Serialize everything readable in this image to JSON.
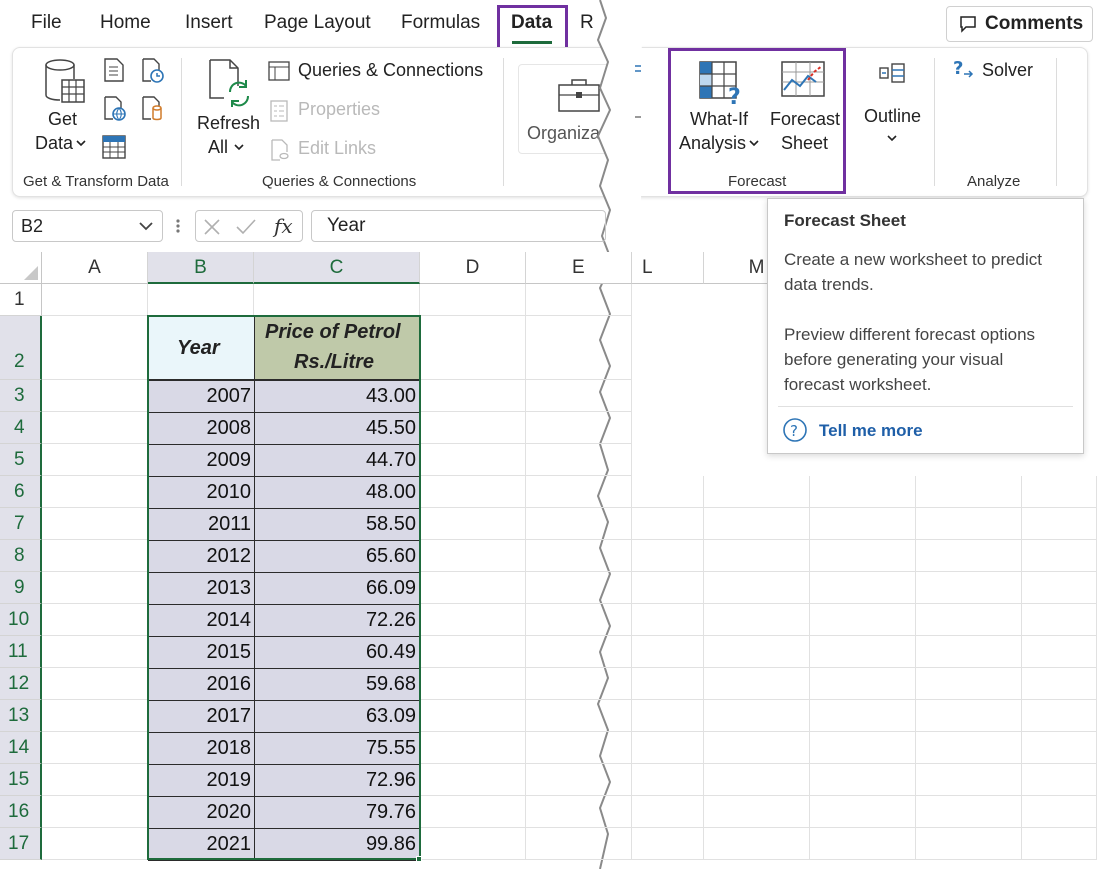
{
  "tabs": [
    "File",
    "Home",
    "Insert",
    "Page Layout",
    "Formulas",
    "Data",
    "R"
  ],
  "active_tab": "Data",
  "comments_label": "Comments",
  "ribbon": {
    "get_data": {
      "line1": "Get",
      "line2": "Data"
    },
    "queries_connections": "Queries & Connections",
    "properties": "Properties",
    "edit_links": "Edit Links",
    "refresh": {
      "line1": "Refresh",
      "line2": "All"
    },
    "organization": "Organizat",
    "what_if": {
      "line1": "What-If",
      "line2": "Analysis"
    },
    "forecast_sheet": {
      "line1": "Forecast",
      "line2": "Sheet"
    },
    "outline": "Outline",
    "solver": "Solver",
    "groups": {
      "get_transform": "Get & Transform Data",
      "queries": "Queries & Connections",
      "forecast": "Forecast",
      "analyze": "Analyze"
    }
  },
  "formula_bar": {
    "name_box": "B2",
    "fx": "fx",
    "content": "Year"
  },
  "columns": [
    "A",
    "B",
    "C",
    "D",
    "E",
    "L",
    "M"
  ],
  "rows": [
    "1",
    "2",
    "3",
    "4",
    "5",
    "6",
    "7",
    "8",
    "9",
    "10",
    "11",
    "12",
    "13",
    "14",
    "15",
    "16",
    "17"
  ],
  "table": {
    "header_year": "Year",
    "header_price_line1": "Price of Petrol",
    "header_price_line2": "Rs./Litre",
    "rows": [
      {
        "year": "2007",
        "price": "43.00"
      },
      {
        "year": "2008",
        "price": "45.50"
      },
      {
        "year": "2009",
        "price": "44.70"
      },
      {
        "year": "2010",
        "price": "48.00"
      },
      {
        "year": "2011",
        "price": "58.50"
      },
      {
        "year": "2012",
        "price": "65.60"
      },
      {
        "year": "2013",
        "price": "66.09"
      },
      {
        "year": "2014",
        "price": "72.26"
      },
      {
        "year": "2015",
        "price": "60.49"
      },
      {
        "year": "2016",
        "price": "59.68"
      },
      {
        "year": "2017",
        "price": "63.09"
      },
      {
        "year": "2018",
        "price": "75.55"
      },
      {
        "year": "2019",
        "price": "72.96"
      },
      {
        "year": "2020",
        "price": "79.76"
      },
      {
        "year": "2021",
        "price": "99.86"
      }
    ]
  },
  "tooltip": {
    "title": "Forecast Sheet",
    "line1": "Create a new worksheet to predict",
    "line2": "data trends.",
    "line3": "Preview different forecast options",
    "line4": "before generating your visual",
    "line5": "forecast worksheet.",
    "link": "Tell me more"
  },
  "colors": {
    "accent": "#1e6b3c",
    "highlight": "#7030a0",
    "selection": "#d9d9e6",
    "header_fill": "#bfc9a9"
  }
}
